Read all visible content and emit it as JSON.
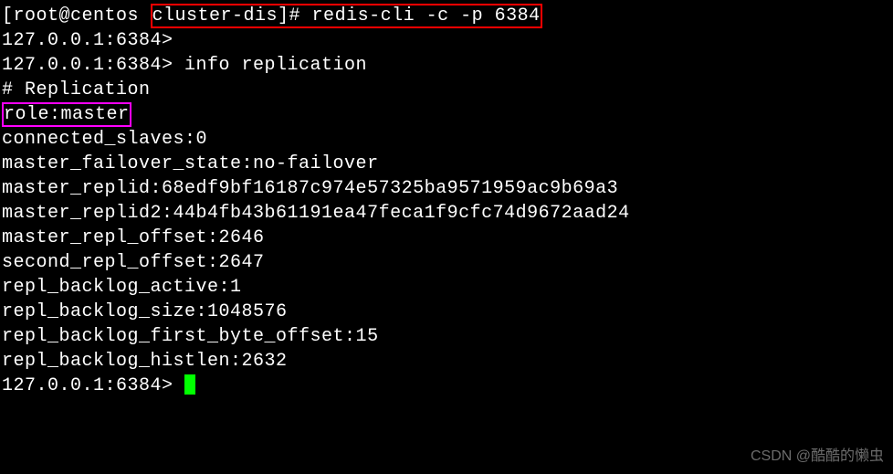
{
  "line1": {
    "prefix": "[root@centos ",
    "boxed": "cluster-dis]# redis-cli -c -p 6384"
  },
  "prompt_empty": "127.0.0.1:6384>",
  "prompt_info": "127.0.0.1:6384> info replication",
  "replication_header": "# Replication",
  "role_line": "role:master",
  "output": {
    "connected_slaves": "connected_slaves:0",
    "master_failover_state": "master_failover_state:no-failover",
    "master_replid": "master_replid:68edf9bf16187c974e57325ba9571959ac9b69a3",
    "master_replid2": "master_replid2:44b4fb43b61191ea47feca1f9cfc74d9672aad24",
    "master_repl_offset": "master_repl_offset:2646",
    "second_repl_offset": "second_repl_offset:2647",
    "repl_backlog_active": "repl_backlog_active:1",
    "repl_backlog_size": "repl_backlog_size:1048576",
    "repl_backlog_first_byte_offset": "repl_backlog_first_byte_offset:15",
    "repl_backlog_histlen": "repl_backlog_histlen:2632"
  },
  "prompt_cursor": "127.0.0.1:6384> ",
  "watermark": "CSDN @酷酷的懒虫"
}
